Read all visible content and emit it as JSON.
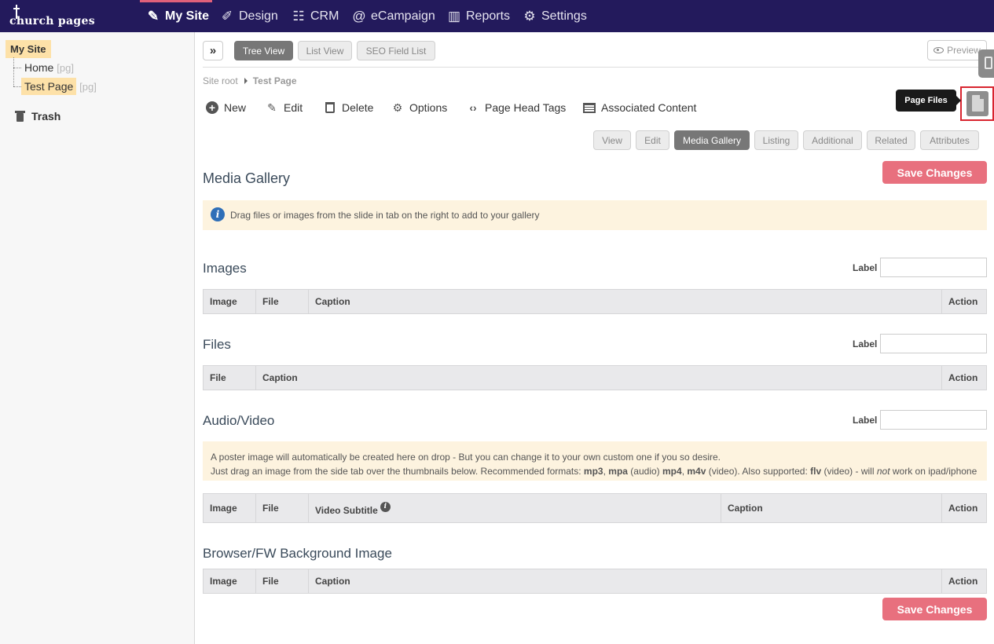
{
  "topnav": {
    "logo": "church pages",
    "items": [
      {
        "label": "My Site",
        "icon": "page-edit-icon"
      },
      {
        "label": "Design",
        "icon": "brush-icon"
      },
      {
        "label": "CRM",
        "icon": "contacts-icon"
      },
      {
        "label": "eCampaign",
        "icon": "at-icon"
      },
      {
        "label": "Reports",
        "icon": "bar-chart-icon"
      },
      {
        "label": "Settings",
        "icon": "gear-icon"
      }
    ],
    "active_color": "#e0607a",
    "bg_color": "#231a5c"
  },
  "sidebar": {
    "root": "My Site",
    "items": [
      {
        "label": "Home",
        "tag": "[pg]"
      },
      {
        "label": "Test Page",
        "tag": "[pg]"
      }
    ],
    "trash": "Trash"
  },
  "toolbar": {
    "view_tabs": [
      "Tree View",
      "List View",
      "SEO Field List"
    ],
    "preview": "Preview",
    "tooltip": "Page Files"
  },
  "breadcrumb": {
    "root": "Site root",
    "current": "Test Page"
  },
  "actions": [
    "New",
    "Edit",
    "Delete",
    "Options",
    "Page Head Tags",
    "Associated Content"
  ],
  "subtabs": [
    "View",
    "Edit",
    "Media Gallery",
    "Listing",
    "Additional",
    "Related",
    "Attributes"
  ],
  "media": {
    "title": "Media Gallery",
    "save": "Save Changes",
    "info": "Drag files or images from the slide in tab on the right to add to your gallery",
    "label": "Label",
    "images": {
      "title": "Images",
      "cols": [
        "Image",
        "File",
        "Caption",
        "Action"
      ]
    },
    "files": {
      "title": "Files",
      "cols": [
        "File",
        "Caption",
        "Action"
      ]
    },
    "av": {
      "title": "Audio/Video",
      "note1": "A poster image will automatically be created here on drop - But you can change it to your own custom one if you so desire.",
      "note2a": "Just drag an image from the side tab over the thumbnails below. Recommended formats: ",
      "f1": "mp3",
      "c1": ", ",
      "f2": "mpa",
      "t1": " (audio) ",
      "f3": "mp4",
      "c2": ", ",
      "f4": "m4v",
      "t2": " (video). Also supported: ",
      "f5": "flv",
      "t3": " (video) - will ",
      "em": "not",
      "t4": " work on ipad/iphone",
      "cols": [
        "Image",
        "File",
        "Video Subtitle",
        "Caption",
        "Action"
      ]
    },
    "bg": {
      "title": "Browser/FW Background Image",
      "cols": [
        "Image",
        "File",
        "Caption",
        "Action"
      ]
    }
  },
  "colors": {
    "save": "#e8707e",
    "info_bg": "#fdf3df",
    "highlight": "#fde1a8",
    "tab_active": "#777777"
  }
}
